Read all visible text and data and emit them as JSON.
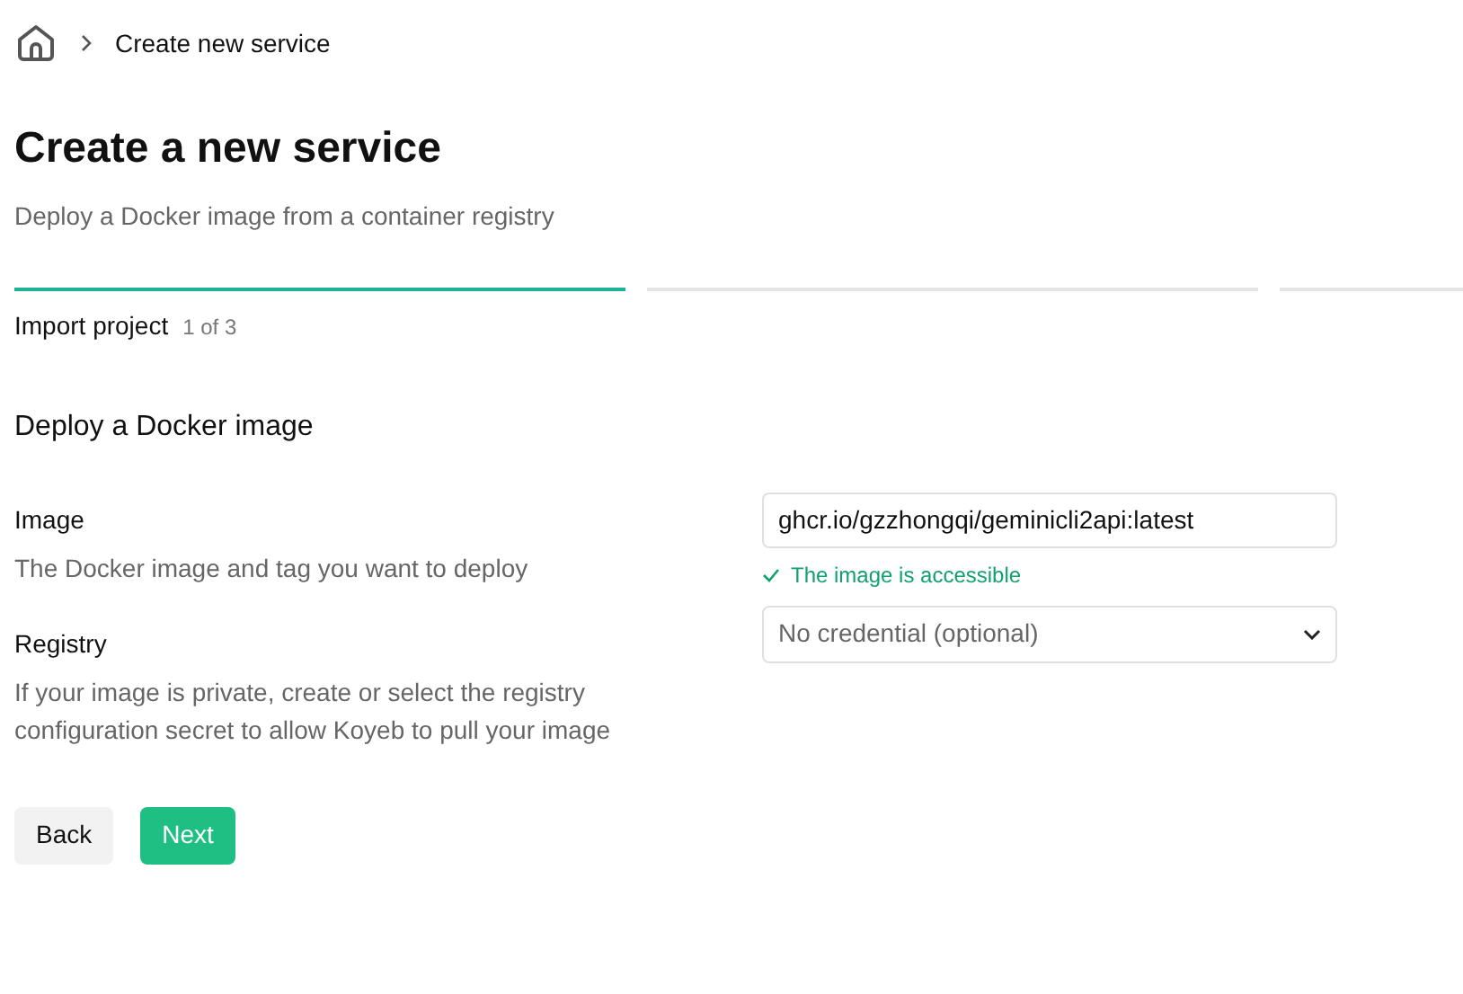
{
  "breadcrumb": {
    "current": "Create new service"
  },
  "header": {
    "title": "Create a new service",
    "subtitle": "Deploy a Docker image from a container registry"
  },
  "steps": [
    {
      "active": true
    },
    {
      "active": false
    },
    {
      "active": false
    }
  ],
  "step_label": {
    "name": "Import project",
    "count": "1 of 3"
  },
  "section_title": "Deploy a Docker image",
  "fields": [
    {
      "kind": "text",
      "label": "Image",
      "help": "The Docker image and tag you want to deploy",
      "value": "ghcr.io/gzzhongqi/geminicli2api:latest",
      "status": {
        "kind": "success",
        "text": "The image is accessible"
      }
    },
    {
      "kind": "select",
      "label": "Registry",
      "help": "If your image is private, create or select the registry configuration secret to allow Koyeb to pull your image",
      "placeholder": "No credential (optional)"
    }
  ],
  "buttons": [
    {
      "label": "Back",
      "kind": "secondary"
    },
    {
      "label": "Next",
      "kind": "primary"
    }
  ]
}
